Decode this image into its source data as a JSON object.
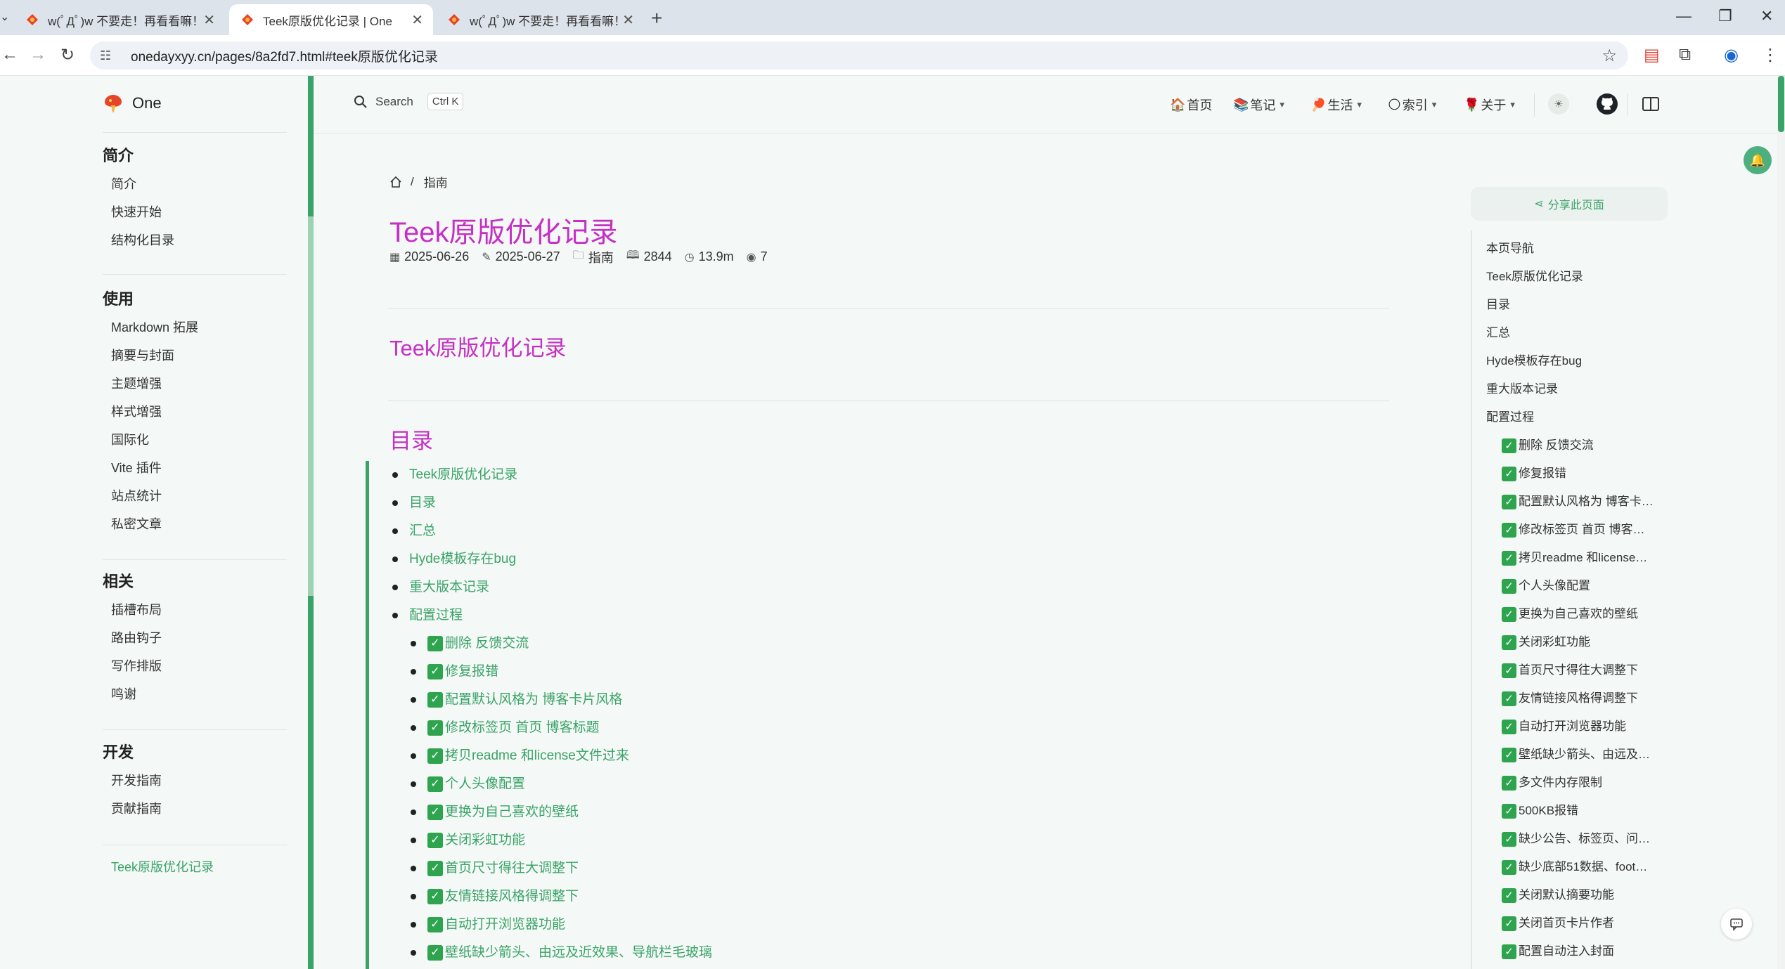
{
  "browser": {
    "tabs": [
      {
        "title": "w(ﾟДﾟ)w 不要走！再看看嘛！",
        "active": false
      },
      {
        "title": "Teek原版优化记录 | One",
        "active": true
      },
      {
        "title": "w(ﾟДﾟ)w 不要走！再看看嘛！",
        "active": false
      }
    ],
    "url": "onedayxyy.cn/pages/8a2fd7.html#teek原版优化记录",
    "accent_color": "#dde3ea"
  },
  "site": {
    "logo_text": "One",
    "brand_color": "#3aa368",
    "title_color": "#c530c4",
    "search": {
      "label": "Search",
      "shortcut": "Ctrl K"
    },
    "nav": [
      {
        "emoji": "🏠",
        "label": "首页",
        "has_menu": false
      },
      {
        "emoji": "📚",
        "label": "笔记",
        "has_menu": true
      },
      {
        "emoji": "🏓",
        "label": "生活",
        "has_menu": true
      },
      {
        "emoji": "🌕",
        "label": "索引",
        "has_menu": true
      },
      {
        "emoji": "🌹",
        "label": "关于",
        "has_menu": true
      }
    ]
  },
  "sidebar": {
    "groups": [
      {
        "title": "简介",
        "items": [
          "简介",
          "快速开始",
          "结构化目录"
        ]
      },
      {
        "title": "使用",
        "items": [
          "Markdown 拓展",
          "摘要与封面",
          "主题增强",
          "样式增强",
          "国际化",
          "Vite 插件",
          "站点统计",
          "私密文章"
        ]
      },
      {
        "title": "相关",
        "items": [
          "插槽布局",
          "路由钩子",
          "写作排版",
          "鸣谢"
        ]
      },
      {
        "title": "开发",
        "items": [
          "开发指南",
          "贡献指南"
        ]
      }
    ],
    "current": "Teek原版优化记录"
  },
  "article": {
    "breadcrumb": "指南",
    "title": "Teek原版优化记录",
    "meta": {
      "created": "2025-06-26",
      "updated": "2025-06-27",
      "category": "指南",
      "words": "2844",
      "read_time": "13.9m",
      "views": "7"
    },
    "h2_first": "Teek原版优化记录",
    "h2_toc": "目录",
    "toc": [
      {
        "label": "Teek原版优化记录",
        "sub": false,
        "done": false
      },
      {
        "label": "目录",
        "sub": false,
        "done": false
      },
      {
        "label": "汇总",
        "sub": false,
        "done": false
      },
      {
        "label": "Hyde模板存在bug",
        "sub": false,
        "done": false
      },
      {
        "label": "重大版本记录",
        "sub": false,
        "done": false
      },
      {
        "label": "配置过程",
        "sub": false,
        "done": false
      },
      {
        "label": "删除 反馈交流",
        "sub": true,
        "done": true
      },
      {
        "label": "修复报错",
        "sub": true,
        "done": true
      },
      {
        "label": "配置默认风格为 博客卡片风格",
        "sub": true,
        "done": true
      },
      {
        "label": "修改标签页 首页 博客标题",
        "sub": true,
        "done": true
      },
      {
        "label": "拷贝readme 和license文件过来",
        "sub": true,
        "done": true
      },
      {
        "label": "个人头像配置",
        "sub": true,
        "done": true
      },
      {
        "label": "更换为自己喜欢的壁纸",
        "sub": true,
        "done": true
      },
      {
        "label": "关闭彩虹功能",
        "sub": true,
        "done": true
      },
      {
        "label": "首页尺寸得往大调整下",
        "sub": true,
        "done": true
      },
      {
        "label": "友情链接风格得调整下",
        "sub": true,
        "done": true
      },
      {
        "label": "自动打开浏览器功能",
        "sub": true,
        "done": true
      },
      {
        "label": "壁纸缺少箭头、由远及近效果、导航栏毛玻璃",
        "sub": true,
        "done": true
      }
    ]
  },
  "aside": {
    "share_label": "分享此页面",
    "items": [
      {
        "label": "本页导航",
        "sub": false,
        "done": false
      },
      {
        "label": "Teek原版优化记录",
        "sub": false,
        "done": false
      },
      {
        "label": "目录",
        "sub": false,
        "done": false
      },
      {
        "label": "汇总",
        "sub": false,
        "done": false
      },
      {
        "label": "Hyde模板存在bug",
        "sub": false,
        "done": false
      },
      {
        "label": "重大版本记录",
        "sub": false,
        "done": false
      },
      {
        "label": "配置过程",
        "sub": false,
        "done": false
      },
      {
        "label": "删除 反馈交流",
        "sub": true,
        "done": true
      },
      {
        "label": "修复报错",
        "sub": true,
        "done": true
      },
      {
        "label": "配置默认风格为 博客卡…",
        "sub": true,
        "done": true
      },
      {
        "label": "修改标签页 首页 博客…",
        "sub": true,
        "done": true
      },
      {
        "label": "拷贝readme 和license…",
        "sub": true,
        "done": true
      },
      {
        "label": "个人头像配置",
        "sub": true,
        "done": true
      },
      {
        "label": "更换为自己喜欢的壁纸",
        "sub": true,
        "done": true
      },
      {
        "label": "关闭彩虹功能",
        "sub": true,
        "done": true
      },
      {
        "label": "首页尺寸得往大调整下",
        "sub": true,
        "done": true
      },
      {
        "label": "友情链接风格得调整下",
        "sub": true,
        "done": true
      },
      {
        "label": "自动打开浏览器功能",
        "sub": true,
        "done": true
      },
      {
        "label": "壁纸缺少箭头、由远及…",
        "sub": true,
        "done": true
      },
      {
        "label": "多文件内存限制",
        "sub": true,
        "done": true
      },
      {
        "label": "500KB报错",
        "sub": true,
        "done": true
      },
      {
        "label": "缺少公告、标签页、问…",
        "sub": true,
        "done": true
      },
      {
        "label": "缺少底部51数据、foot…",
        "sub": true,
        "done": true
      },
      {
        "label": "关闭默认摘要功能",
        "sub": true,
        "done": true
      },
      {
        "label": "关闭首页卡片作者",
        "sub": true,
        "done": true
      },
      {
        "label": "配置自动注入封面",
        "sub": true,
        "done": true
      }
    ]
  }
}
